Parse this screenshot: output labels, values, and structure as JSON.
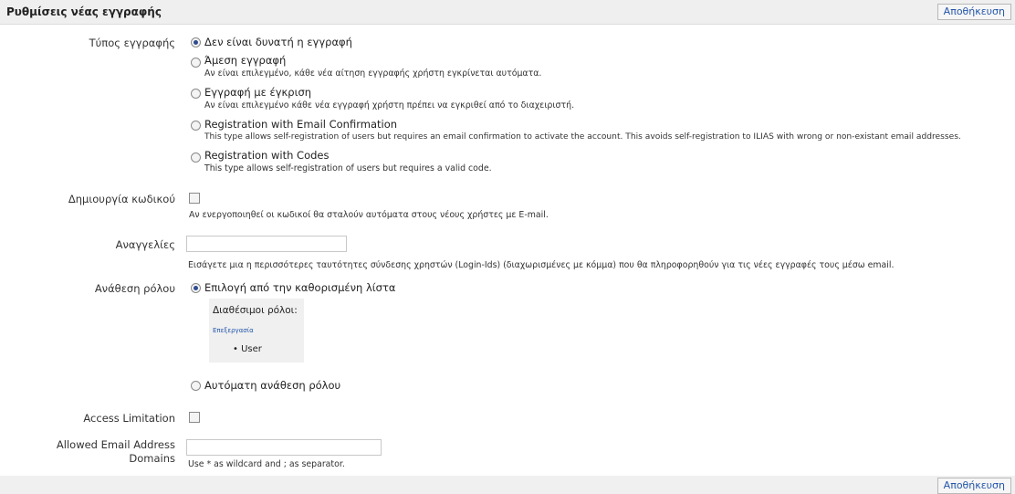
{
  "header": {
    "title": "Ρυθμίσεις νέας εγγραφής",
    "save_label": "Αποθήκευση"
  },
  "footer": {
    "save_label": "Αποθήκευση"
  },
  "registration_type": {
    "label": "Τύπος εγγραφής",
    "options": [
      {
        "label": "Δεν είναι δυνατή η εγγραφή",
        "desc": "",
        "selected": true
      },
      {
        "label": "Άμεση εγγραφή",
        "desc": "Αν είναι επιλεγμένο, κάθε νέα αίτηση εγγραφής χρήστη εγκρίνεται αυτόματα.",
        "selected": false
      },
      {
        "label": "Εγγραφή με έγκριση",
        "desc": "Αν είναι επιλεγμένο κάθε νέα εγγραφή χρήστη πρέπει να εγκριθεί από το διαχειριστή.",
        "selected": false
      },
      {
        "label": "Registration with Email Confirmation",
        "desc": "This type allows self-registration of users but requires an email confirmation to activate the account. This avoids self-registration to ILIAS with wrong or non-existant email addresses.",
        "selected": false
      },
      {
        "label": "Registration with Codes",
        "desc": "This type allows self-registration of users but requires a valid code.",
        "selected": false
      }
    ]
  },
  "password_generation": {
    "label": "Δημιουργία κωδικού",
    "checked": false,
    "desc": "Αν ενεργοποιηθεί οι κωδικοί θα σταλούν αυτόματα στους νέους χρήστες με E-mail."
  },
  "notifications": {
    "label": "Αναγγελίες",
    "value": "",
    "desc": "Εισάγετε μια η περισσότερες ταυτότητες σύνδεσης χρηστών (Login-Ids) (διαχωρισμένες με κόμμα) που θα πληροφορηθούν για τις νέες εγγραφές τους μέσω email."
  },
  "role_assignment": {
    "label": "Ανάθεση ρόλου",
    "option_fixed": "Επιλογή από την καθορισμένη λίστα",
    "available_roles_title": "Διαθέσιμοι ρόλοι:",
    "edit_link": "Επεξεργασία",
    "roles": [
      "User"
    ],
    "option_automatic": "Αυτόματη ανάθεση ρόλου"
  },
  "access_limitation": {
    "label": "Access Limitation",
    "checked": false
  },
  "allowed_domains": {
    "label_line1": "Allowed Email Address",
    "label_line2": "Domains",
    "value": "",
    "desc": "Use * as wildcard and ; as separator."
  }
}
